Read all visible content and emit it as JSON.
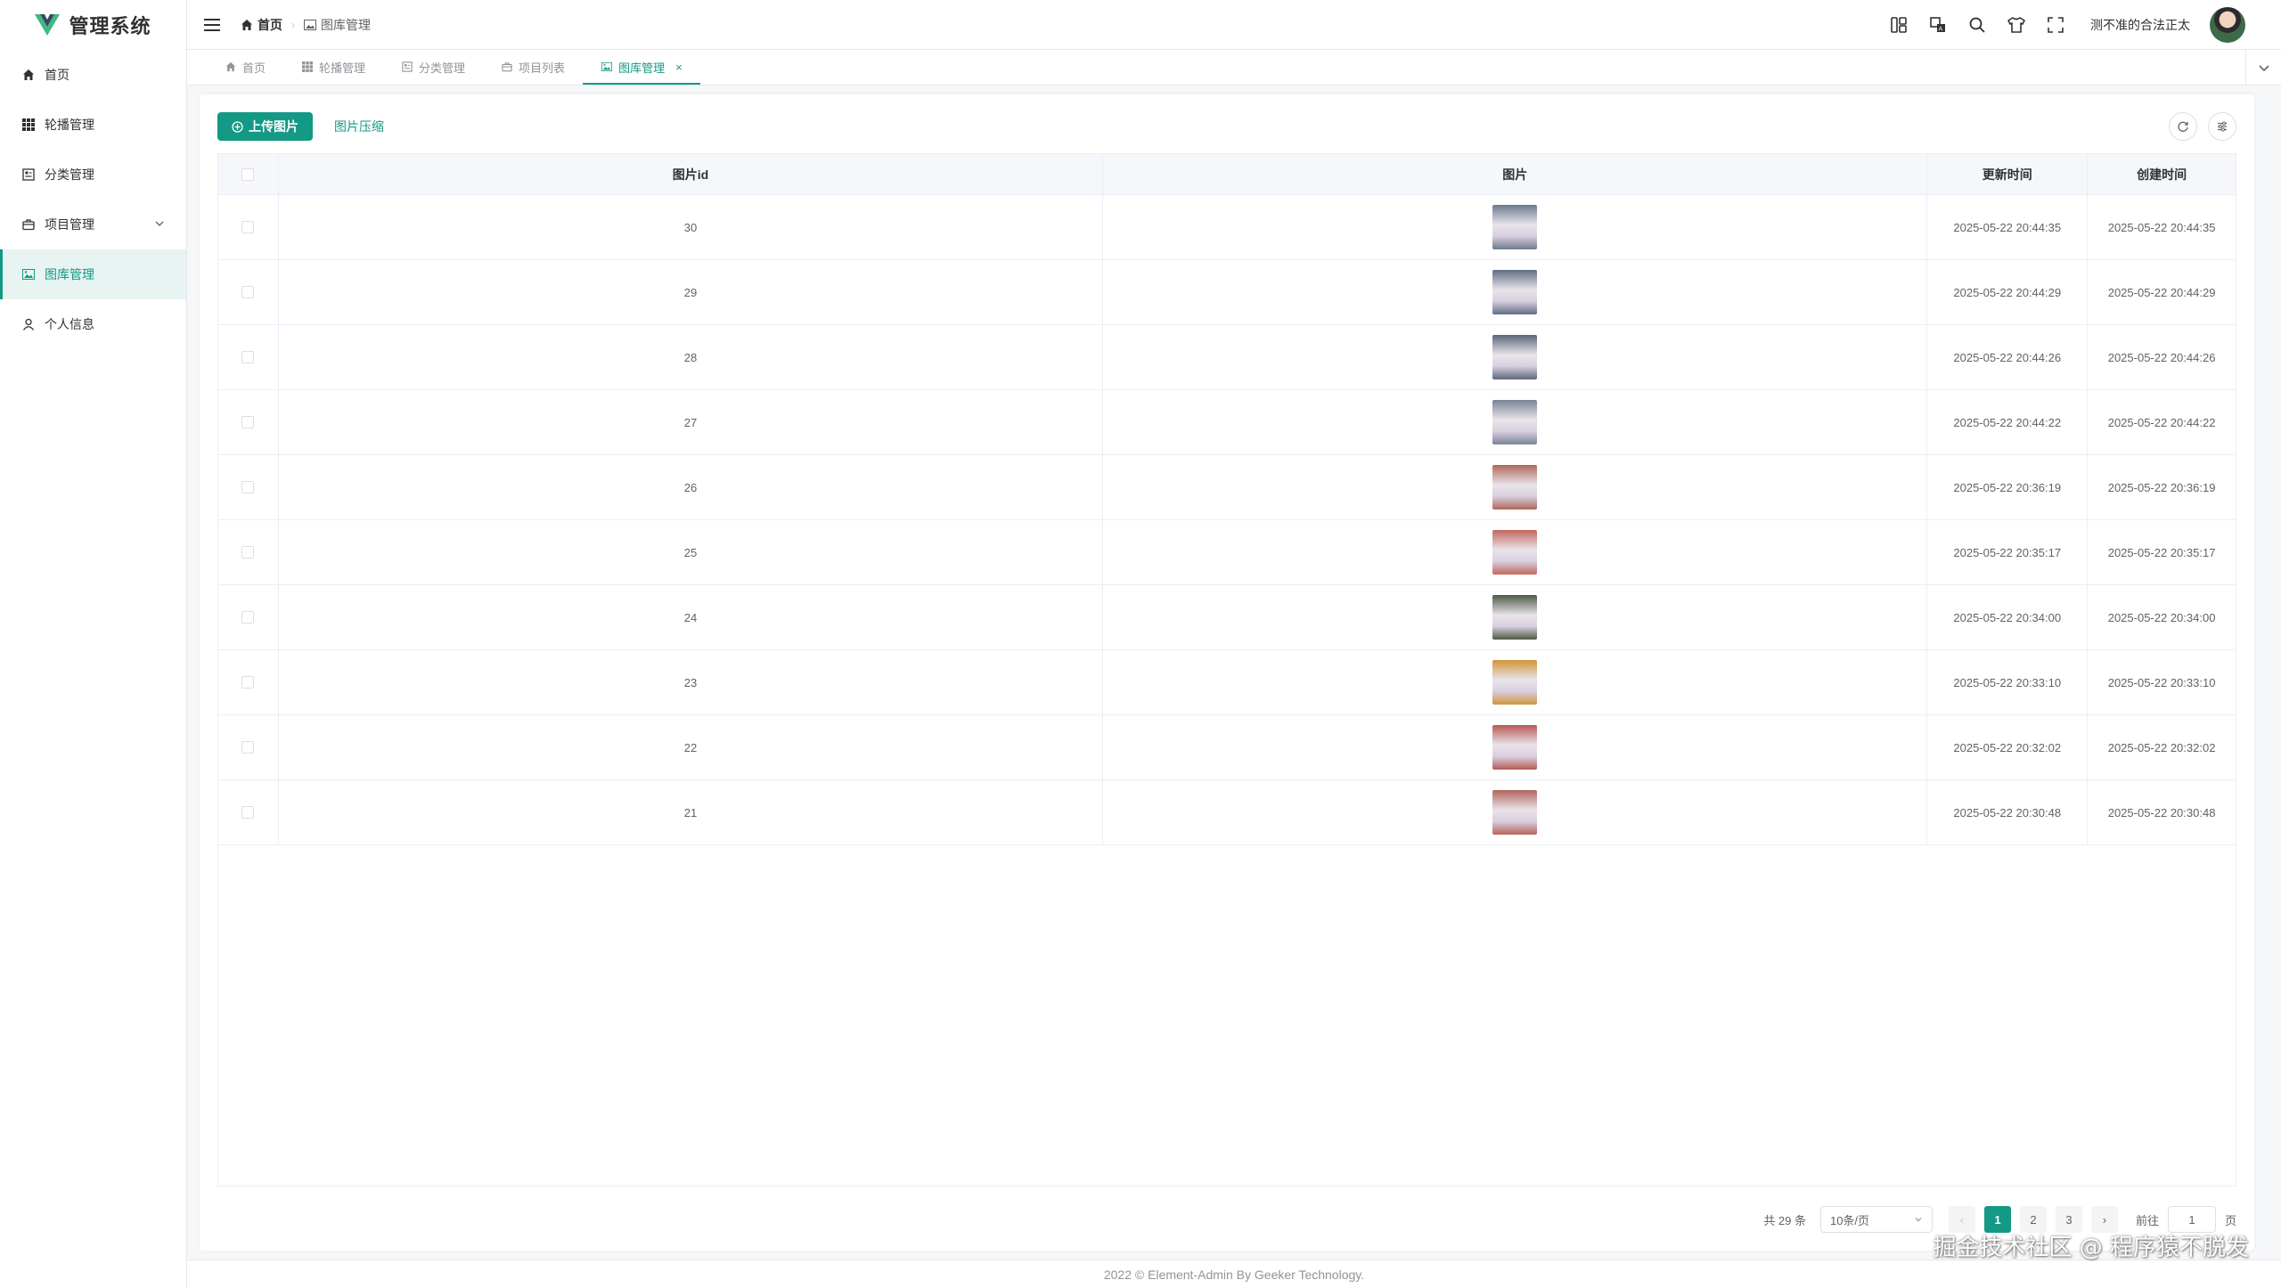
{
  "app": {
    "title": "管理系统"
  },
  "sidebar": {
    "items": [
      {
        "label": "首页",
        "icon": "home-icon"
      },
      {
        "label": "轮播管理",
        "icon": "grid-icon"
      },
      {
        "label": "分类管理",
        "icon": "category-icon"
      },
      {
        "label": "项目管理",
        "icon": "briefcase-icon",
        "expandable": true
      },
      {
        "label": "图库管理",
        "icon": "image-icon",
        "active": true
      },
      {
        "label": "个人信息",
        "icon": "user-icon"
      }
    ]
  },
  "header": {
    "breadcrumb": [
      {
        "label": "首页"
      },
      {
        "label": "图库管理"
      }
    ],
    "username": "测不准的合法正太"
  },
  "tabs": [
    {
      "label": "首页"
    },
    {
      "label": "轮播管理"
    },
    {
      "label": "分类管理"
    },
    {
      "label": "项目列表"
    },
    {
      "label": "图库管理",
      "active": true
    }
  ],
  "toolbar": {
    "upload_label": "上传图片",
    "compress_label": "图片压缩"
  },
  "table": {
    "columns": [
      "图片id",
      "图片",
      "更新时间",
      "创建时间"
    ],
    "rows": [
      {
        "id": "30",
        "updated": "2025-05-22 20:44:35",
        "created": "2025-05-22 20:44:35",
        "thumb_color": "#6c7a8e"
      },
      {
        "id": "29",
        "updated": "2025-05-22 20:44:29",
        "created": "2025-05-22 20:44:29",
        "thumb_color": "#5f6d82"
      },
      {
        "id": "28",
        "updated": "2025-05-22 20:44:26",
        "created": "2025-05-22 20:44:26",
        "thumb_color": "#5a6678"
      },
      {
        "id": "27",
        "updated": "2025-05-22 20:44:22",
        "created": "2025-05-22 20:44:22",
        "thumb_color": "#7a8494"
      },
      {
        "id": "26",
        "updated": "2025-05-22 20:36:19",
        "created": "2025-05-22 20:36:19",
        "thumb_color": "#b0665a"
      },
      {
        "id": "25",
        "updated": "2025-05-22 20:35:17",
        "created": "2025-05-22 20:35:17",
        "thumb_color": "#c3675f"
      },
      {
        "id": "24",
        "updated": "2025-05-22 20:34:00",
        "created": "2025-05-22 20:34:00",
        "thumb_color": "#4d5a44"
      },
      {
        "id": "23",
        "updated": "2025-05-22 20:33:10",
        "created": "2025-05-22 20:33:10",
        "thumb_color": "#d1943a"
      },
      {
        "id": "22",
        "updated": "2025-05-22 20:32:02",
        "created": "2025-05-22 20:32:02",
        "thumb_color": "#b85a55"
      },
      {
        "id": "21",
        "updated": "2025-05-22 20:30:48",
        "created": "2025-05-22 20:30:48",
        "thumb_color": "#b4645c"
      }
    ]
  },
  "pagination": {
    "total_label": "共 29 条",
    "page_size_label": "10条/页",
    "pages": [
      "1",
      "2",
      "3"
    ],
    "current": "1",
    "goto_prefix": "前往",
    "goto_value": "1",
    "goto_suffix": "页"
  },
  "footer": {
    "text": "2022 © Element-Admin By Geeker Technology."
  },
  "watermark": {
    "text": "掘金技术社区 @ 程序猿不脱发"
  },
  "colors": {
    "accent": "#139985"
  }
}
